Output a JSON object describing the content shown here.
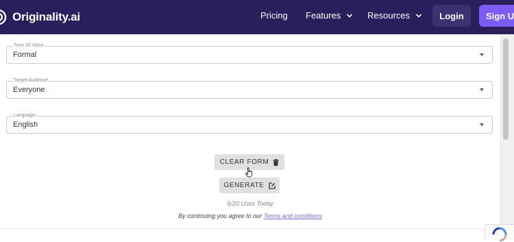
{
  "header": {
    "brand": "Originality.ai",
    "nav": [
      {
        "label": "Pricing",
        "has_dropdown": false
      },
      {
        "label": "Features",
        "has_dropdown": true
      },
      {
        "label": "Resources",
        "has_dropdown": true
      }
    ],
    "login_label": "Login",
    "signup_label": "Sign Up"
  },
  "form": {
    "tone": {
      "label": "Tone Of Voice",
      "value": "Formal"
    },
    "audience": {
      "label": "Target Audience",
      "value": "Everyone"
    },
    "language": {
      "label": "Language",
      "value": "English"
    }
  },
  "actions": {
    "clear_label": "CLEAR FORM",
    "generate_label": "GENERATE",
    "uses_text": "6/20 Uses Today",
    "agree_prefix": "By continuing you agree to our ",
    "terms_label": "Terms and conditions"
  },
  "colors": {
    "header_bg": "#2a1e5c",
    "signup_bg": "#7c5cf5",
    "login_bg": "#3b3273",
    "link": "#7b6fd6"
  },
  "icons": {
    "brand": "logo-icon",
    "clear": "trash-icon",
    "generate": "edit-icon",
    "dropdown": "caret-down-icon",
    "cursor": "hand-pointer-icon"
  }
}
